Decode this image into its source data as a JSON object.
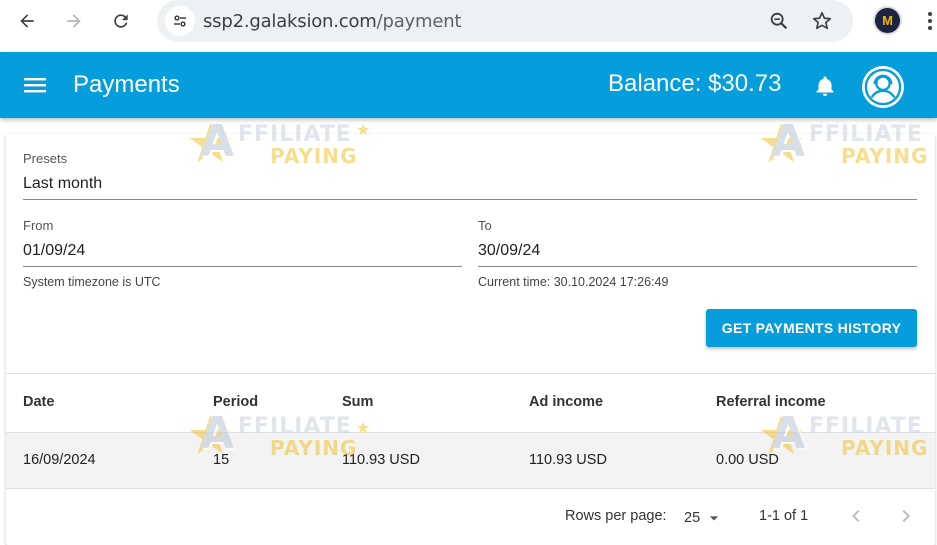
{
  "browser": {
    "url_host": "ssp2.galaksion.com",
    "url_path": "/payment",
    "extension_label": "M"
  },
  "appbar": {
    "title": "Payments",
    "balance": "Balance: $30.73"
  },
  "filters": {
    "presets_label": "Presets",
    "presets_value": "Last month",
    "from_label": "From",
    "from_value": "01/09/24",
    "to_label": "To",
    "to_value": "30/09/24",
    "timezone_hint": "System timezone is UTC",
    "current_time_hint": "Current time: 30.10.2024 17:26:49",
    "submit_label": "GET PAYMENTS HISTORY"
  },
  "table": {
    "headers": [
      "Date",
      "Period",
      "Sum",
      "Ad income",
      "Referral income"
    ],
    "rows": [
      [
        "16/09/2024",
        "15",
        "110.93 USD",
        "110.93 USD",
        "0.00 USD"
      ]
    ]
  },
  "pagination": {
    "rows_per_page_label": "Rows per page:",
    "rows_per_page_value": "25",
    "range": "1-1 of 1"
  },
  "watermark": {
    "letter": "A",
    "line1": "FFILIATE",
    "line2": "PAYING"
  },
  "colors": {
    "primary": "#069ddc",
    "appbar_text": "#ffffff"
  }
}
